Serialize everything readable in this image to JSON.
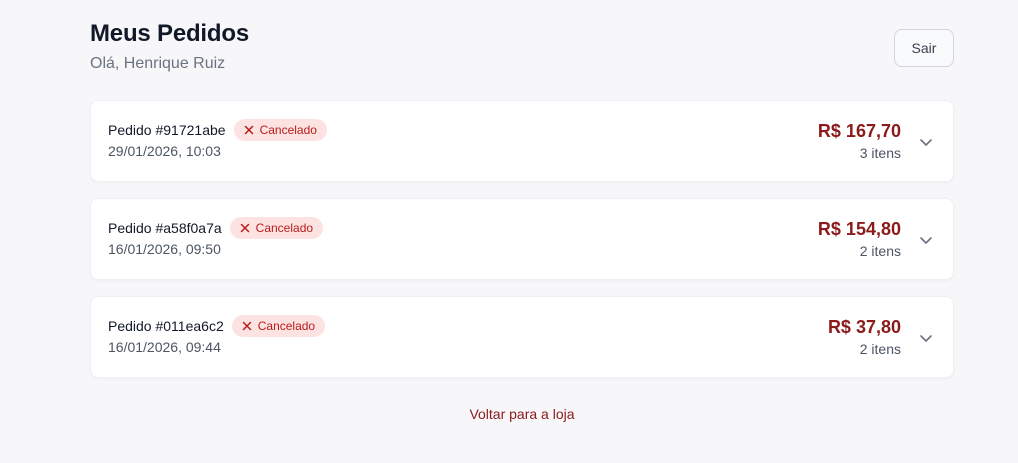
{
  "header": {
    "title": "Meus Pedidos",
    "greeting": "Olá, Henrique Ruiz",
    "logout_label": "Sair"
  },
  "orders": [
    {
      "id_label": "Pedido #91721abe",
      "status": "Cancelado",
      "date": "29/01/2026, 10:03",
      "total": "R$ 167,70",
      "items": "3 itens"
    },
    {
      "id_label": "Pedido #a58f0a7a",
      "status": "Cancelado",
      "date": "16/01/2026, 09:50",
      "total": "R$ 154,80",
      "items": "2 itens"
    },
    {
      "id_label": "Pedido #011ea6c2",
      "status": "Cancelado",
      "date": "16/01/2026, 09:44",
      "total": "R$ 37,80",
      "items": "2 itens"
    }
  ],
  "footer": {
    "back_link": "Voltar para a loja"
  },
  "icons": {
    "status": "x-icon",
    "expand": "chevron-down-icon"
  },
  "colors": {
    "accent": "#8b1a1a",
    "badge_bg": "#fde2e2",
    "badge_text": "#b91c1c",
    "background": "#f7f7f9"
  }
}
